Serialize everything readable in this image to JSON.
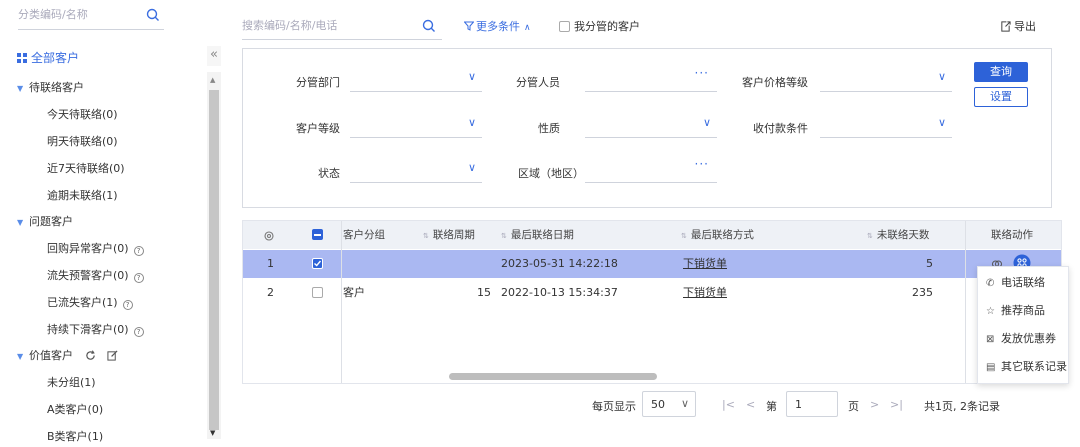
{
  "sidebar": {
    "search_placeholder": "分类编码/名称",
    "root": "全部客户",
    "groups": [
      {
        "label": "待联络客户",
        "items": [
          "今天待联络(0)",
          "明天待联络(0)",
          "近7天待联络(0)",
          "逾期未联络(1)"
        ]
      },
      {
        "label": "问题客户",
        "items": [
          "回购异常客户(0)",
          "流失预警客户(0)",
          "已流失客户(1)",
          "持续下滑客户(0)"
        ]
      },
      {
        "label": "价值客户",
        "items": [
          "未分组(1)",
          "A类客户(0)",
          "B类客户(1)"
        ]
      }
    ]
  },
  "toolbar": {
    "search_placeholder": "搜索编码/名称/电话",
    "more": "更多条件",
    "mine": "我分管的客户",
    "export": "导出"
  },
  "filters": {
    "dept": "分管部门",
    "person": "分管人员",
    "price_level": "客户价格等级",
    "level": "客户等级",
    "nature": "性质",
    "payment": "收付款条件",
    "status": "状态",
    "region": "区域（地区）",
    "query_btn": "查询",
    "settings_btn": "设置"
  },
  "table": {
    "headers": {
      "group": "客户分组",
      "cycle": "联络周期",
      "last_date": "最后联络日期",
      "last_method": "最后联络方式",
      "days": "未联络天数",
      "action": "联络动作"
    },
    "rows": [
      {
        "index": "1",
        "group": "",
        "cycle": "",
        "last_date": "2023-05-31 14:22:18",
        "last_method": "下销货单",
        "days": "5",
        "checked": true
      },
      {
        "index": "2",
        "group": "客户",
        "cycle": "15",
        "last_date": "2022-10-13 15:34:37",
        "last_method": "下销货单",
        "days": "235",
        "checked": false
      }
    ]
  },
  "action_menu": {
    "items": [
      "电话联络",
      "推荐商品",
      "发放优惠券",
      "其它联系记录"
    ]
  },
  "pagination": {
    "per_page_label": "每页显示",
    "per_page": "50",
    "page_prefix": "第",
    "page": "1",
    "page_suffix": "页",
    "summary": "共1页, 2条记录"
  },
  "colors": {
    "accent": "#2d62d8",
    "selected_row": "#aab8f2",
    "header_bg": "#eef1f6"
  }
}
